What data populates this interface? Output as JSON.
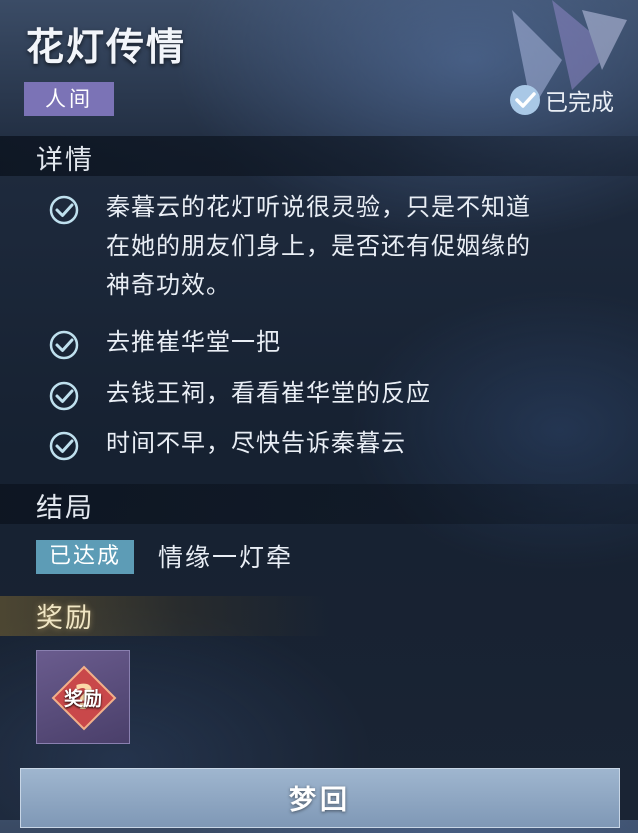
{
  "header": {
    "title": "花灯传情",
    "tag": "人间",
    "status": "已完成"
  },
  "details": {
    "heading": "详情",
    "items": [
      {
        "text": "秦暮云的花灯听说很灵验，只是不知道在她的朋友们身上，是否还有促姻缘的神奇功效。",
        "lines": [
          "秦暮云的花灯听说很灵验，只是不知道",
          "在她的朋友们身上，是否还有促姻缘的",
          "神奇功效。"
        ]
      },
      {
        "text": "去推崔华堂一把"
      },
      {
        "text": "去钱王祠，看看崔华堂的反应"
      },
      {
        "text": "时间不早，尽快告诉秦暮云"
      }
    ]
  },
  "ending": {
    "heading": "结局",
    "badge": "已达成",
    "name": "情缘一灯牵"
  },
  "reward": {
    "heading": "奖励",
    "item_label": "奖励",
    "item_icon": "question-mark-icon"
  },
  "footer": {
    "button_label": "梦回"
  },
  "colors": {
    "tag_bg": "#7b73b6",
    "badge_bg": "#5d9cb6",
    "check_color": "#bfe0ee",
    "button_bg": "#8fa8c4"
  }
}
